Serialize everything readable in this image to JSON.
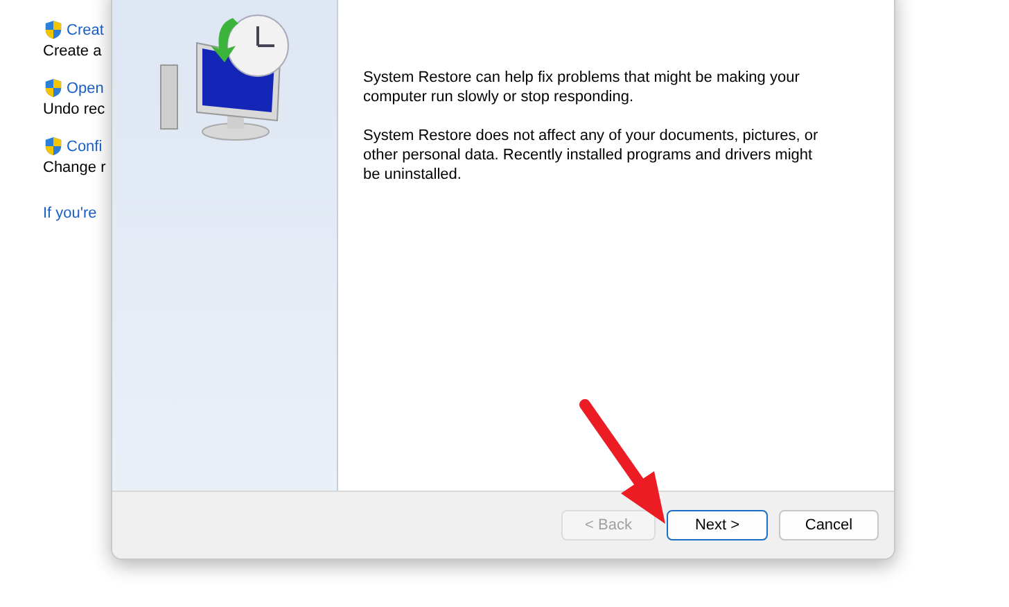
{
  "control_panel": {
    "tasks": [
      {
        "title": "Creat",
        "description": "Create a"
      },
      {
        "title": "Open",
        "description": "Undo rec"
      },
      {
        "title": "Confi",
        "description": "Change r"
      }
    ],
    "link": "If you're"
  },
  "dialog": {
    "paragraphs": [
      "System Restore can help fix problems that might be making your computer run slowly or stop responding.",
      "System Restore does not affect any of your documents, pictures, or other personal data. Recently installed programs and drivers might be uninstalled."
    ],
    "buttons": [
      {
        "label": "< Back",
        "disabled": true,
        "default": false
      },
      {
        "label": "Next >",
        "disabled": false,
        "default": true
      },
      {
        "label": "Cancel",
        "disabled": false,
        "default": false
      }
    ]
  }
}
